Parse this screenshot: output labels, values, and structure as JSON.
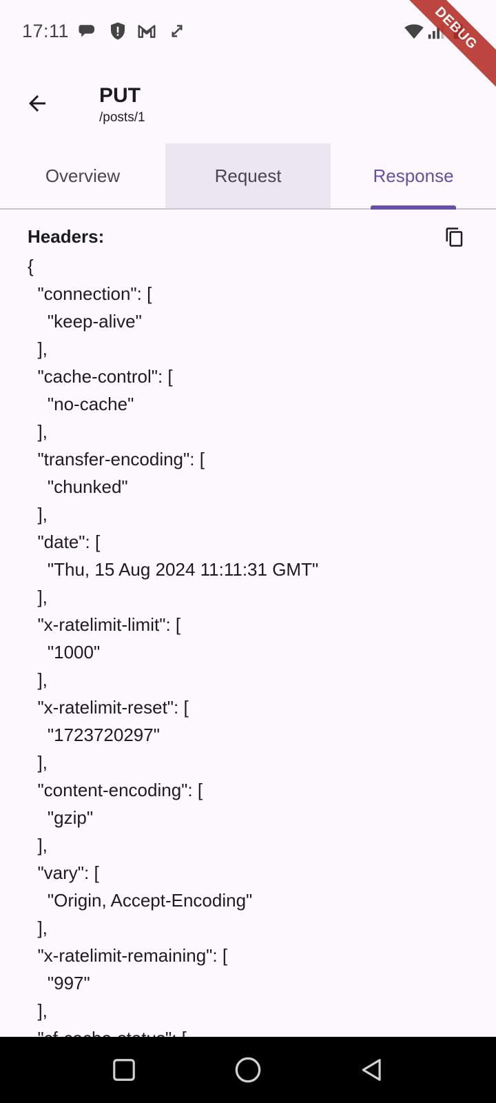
{
  "status_bar": {
    "time": "17:11",
    "icons": [
      "chat-bubble-icon",
      "shield-alert-icon",
      "gmail-icon",
      "sync-icon",
      "wifi-icon",
      "signal-icon",
      "battery-icon"
    ],
    "debug_label": "DEBUG"
  },
  "app_bar": {
    "title": "PUT",
    "subtitle": "/posts/1"
  },
  "tabs": [
    {
      "label": "Overview"
    },
    {
      "label": "Request"
    },
    {
      "label": "Response"
    }
  ],
  "active_tab": "Response",
  "response": {
    "headers_label": "Headers:",
    "headers_json": "{\n  \"connection\": [\n    \"keep-alive\"\n  ],\n  \"cache-control\": [\n    \"no-cache\"\n  ],\n  \"transfer-encoding\": [\n    \"chunked\"\n  ],\n  \"date\": [\n    \"Thu, 15 Aug 2024 11:11:31 GMT\"\n  ],\n  \"x-ratelimit-limit\": [\n    \"1000\"\n  ],\n  \"x-ratelimit-reset\": [\n    \"1723720297\"\n  ],\n  \"content-encoding\": [\n    \"gzip\"\n  ],\n  \"vary\": [\n    \"Origin, Accept-Encoding\"\n  ],\n  \"x-ratelimit-remaining\": [\n    \"997\"\n  ],\n  \"cf-cache-status\": ["
  },
  "colors": {
    "accent": "#6750a4",
    "background": "#fdf7fe",
    "tab_hover": "#ece6f0"
  }
}
